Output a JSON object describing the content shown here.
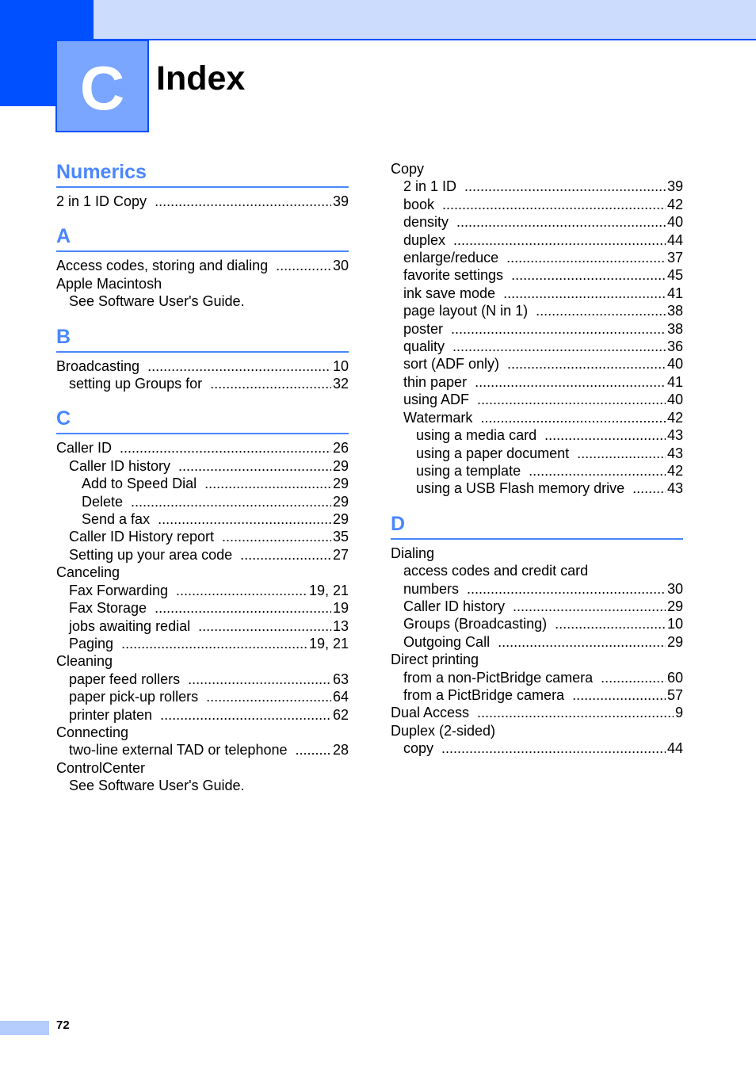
{
  "chapter": {
    "letter": "C",
    "title": "Index"
  },
  "colors": {
    "brand_dark": "#0050ff",
    "brand_light": "#ccdcfd",
    "chapter_box": "#7ba6ff",
    "section_heading": "#4a86ff"
  },
  "left_column": [
    {
      "heading": "Numerics",
      "entries": [
        {
          "level": 1,
          "label": "2 in 1 ID Copy",
          "page": "39"
        }
      ]
    },
    {
      "heading": "A",
      "entries": [
        {
          "level": 1,
          "label": "Access codes, storing and dialing",
          "page": "30"
        },
        {
          "level": 1,
          "label": "Apple Macintosh",
          "page": ""
        },
        {
          "level": 2,
          "label": "See Software User's Guide.",
          "page": ""
        }
      ]
    },
    {
      "heading": "B",
      "entries": [
        {
          "level": 1,
          "label": "Broadcasting",
          "page": "10"
        },
        {
          "level": 2,
          "label": "setting up Groups for",
          "page": "32"
        }
      ]
    },
    {
      "heading": "C",
      "entries": [
        {
          "level": 1,
          "label": "Caller ID",
          "page": "26"
        },
        {
          "level": 2,
          "label": "Caller ID history",
          "page": "29"
        },
        {
          "level": 3,
          "label": "Add to Speed Dial",
          "page": "29"
        },
        {
          "level": 3,
          "label": "Delete",
          "page": "29"
        },
        {
          "level": 3,
          "label": "Send a fax",
          "page": "29"
        },
        {
          "level": 2,
          "label": "Caller ID History report",
          "page": "35"
        },
        {
          "level": 2,
          "label": "Setting up your area code",
          "page": "27"
        },
        {
          "level": 1,
          "label": "Canceling",
          "page": ""
        },
        {
          "level": 2,
          "label": "Fax Forwarding",
          "page": "19, 21"
        },
        {
          "level": 2,
          "label": "Fax Storage",
          "page": "19"
        },
        {
          "level": 2,
          "label": "jobs awaiting redial",
          "page": "13"
        },
        {
          "level": 2,
          "label": "Paging",
          "page": "19, 21"
        },
        {
          "level": 1,
          "label": "Cleaning",
          "page": ""
        },
        {
          "level": 2,
          "label": "paper feed rollers",
          "page": "63"
        },
        {
          "level": 2,
          "label": "paper pick-up rollers",
          "page": "64"
        },
        {
          "level": 2,
          "label": "printer platen",
          "page": "62"
        },
        {
          "level": 1,
          "label": "Connecting",
          "page": ""
        },
        {
          "level": 2,
          "label": "two-line external TAD or telephone",
          "page": "28"
        },
        {
          "level": 1,
          "label": "ControlCenter",
          "page": ""
        },
        {
          "level": 2,
          "label": "See Software User's Guide.",
          "page": ""
        }
      ]
    }
  ],
  "right_column": [
    {
      "heading": "",
      "entries": [
        {
          "level": 1,
          "label": "Copy",
          "page": ""
        },
        {
          "level": 2,
          "label": "2 in 1 ID",
          "page": "39"
        },
        {
          "level": 2,
          "label": "book",
          "page": "42"
        },
        {
          "level": 2,
          "label": "density",
          "page": "40"
        },
        {
          "level": 2,
          "label": "duplex",
          "page": "44"
        },
        {
          "level": 2,
          "label": "enlarge/reduce",
          "page": "37"
        },
        {
          "level": 2,
          "label": "favorite settings",
          "page": "45"
        },
        {
          "level": 2,
          "label": "ink save mode",
          "page": "41"
        },
        {
          "level": 2,
          "label": "page layout (N in 1)",
          "page": "38"
        },
        {
          "level": 2,
          "label": "poster",
          "page": "38"
        },
        {
          "level": 2,
          "label": "quality",
          "page": "36"
        },
        {
          "level": 2,
          "label": "sort (ADF only)",
          "page": "40"
        },
        {
          "level": 2,
          "label": "thin paper",
          "page": "41"
        },
        {
          "level": 2,
          "label": "using ADF",
          "page": "40"
        },
        {
          "level": 2,
          "label": "Watermark",
          "page": "42"
        },
        {
          "level": 3,
          "label": "using a media card",
          "page": "43"
        },
        {
          "level": 3,
          "label": "using a paper document",
          "page": "43"
        },
        {
          "level": 3,
          "label": "using a template",
          "page": "42"
        },
        {
          "level": 3,
          "label": "using a USB Flash memory drive",
          "page": "43"
        }
      ]
    },
    {
      "heading": "D",
      "entries": [
        {
          "level": 1,
          "label": "Dialing",
          "page": ""
        },
        {
          "level": 2,
          "label": "access codes and credit card",
          "page": ""
        },
        {
          "level": 2,
          "label": "numbers",
          "page": "30"
        },
        {
          "level": 2,
          "label": "Caller ID history",
          "page": "29"
        },
        {
          "level": 2,
          "label": "Groups (Broadcasting)",
          "page": "10"
        },
        {
          "level": 2,
          "label": "Outgoing Call",
          "page": "29"
        },
        {
          "level": 1,
          "label": "Direct printing",
          "page": ""
        },
        {
          "level": 2,
          "label": "from a non-PictBridge camera",
          "page": "60"
        },
        {
          "level": 2,
          "label": "from a PictBridge camera",
          "page": "57"
        },
        {
          "level": 1,
          "label": "Dual Access",
          "page": "9"
        },
        {
          "level": 1,
          "label": "Duplex (2-sided)",
          "page": ""
        },
        {
          "level": 2,
          "label": "copy",
          "page": "44"
        }
      ]
    }
  ],
  "footer": {
    "page_number": "72"
  }
}
